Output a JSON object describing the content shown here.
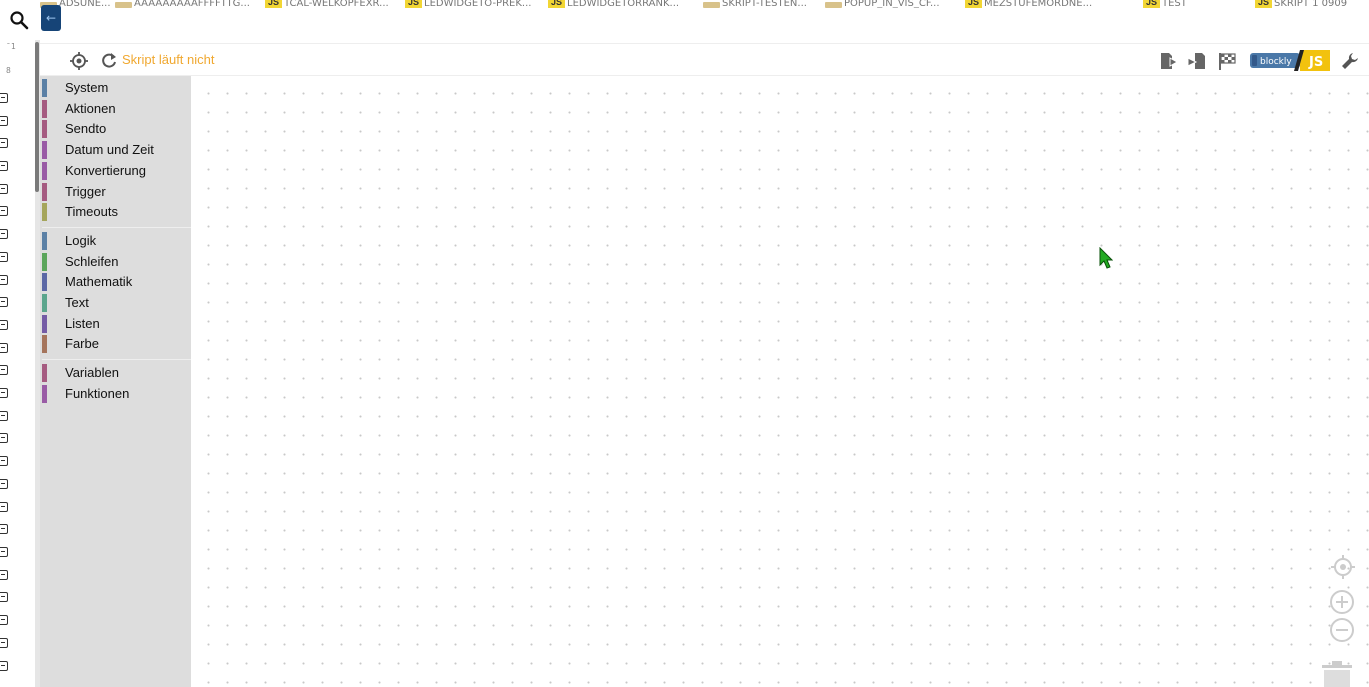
{
  "tabs": [
    {
      "icon": "folder-icon",
      "name": "ADSUNE..."
    },
    {
      "icon": "folder-icon",
      "name": "AAAAAAAAAFFFFTTG..."
    },
    {
      "icon": "js-icon",
      "name": "TCAL-WELKOPFEXR..."
    },
    {
      "icon": "js-icon",
      "name": "LEDWIDGETO-PREK..."
    },
    {
      "icon": "js-icon",
      "name": "LEDWIDGETORRANK..."
    },
    {
      "icon": "folder-icon",
      "name": "SKRIPT-TESTEN..."
    },
    {
      "icon": "folder-icon",
      "name": "POPUP_IN_VIS_CF..."
    },
    {
      "icon": "js-icon",
      "name": "MEZSTUFEMORDNE..."
    },
    {
      "icon": "js-icon",
      "name": "TEST"
    },
    {
      "icon": "js-icon",
      "name": "SKRIPT 1 0909"
    }
  ],
  "tab_js_label": "JS",
  "toolbar": {
    "status": "Skript läuft nicht",
    "blockly_label": "blockly",
    "js_label": "JS"
  },
  "toolbox": {
    "groups": [
      [
        {
          "label": "System",
          "color": "#5b80a5"
        },
        {
          "label": "Aktionen",
          "color": "#a55b80"
        },
        {
          "label": "Sendto",
          "color": "#a55b80"
        },
        {
          "label": "Datum und Zeit",
          "color": "#995ba5"
        },
        {
          "label": "Konvertierung",
          "color": "#995ba5"
        },
        {
          "label": "Trigger",
          "color": "#a55b80"
        },
        {
          "label": "Timeouts",
          "color": "#a5a55b"
        }
      ],
      [
        {
          "label": "Logik",
          "color": "#5b80a5"
        },
        {
          "label": "Schleifen",
          "color": "#5ba55b"
        },
        {
          "label": "Mathematik",
          "color": "#5b67a5"
        },
        {
          "label": "Text",
          "color": "#5ba58c"
        },
        {
          "label": "Listen",
          "color": "#745ba5"
        },
        {
          "label": "Farbe",
          "color": "#a5745b"
        }
      ],
      [
        {
          "label": "Variablen",
          "color": "#a55b80"
        },
        {
          "label": "Funktionen",
          "color": "#995ba5"
        }
      ]
    ]
  },
  "colors": {
    "status": "#f0a830",
    "collapse_button": "#164477",
    "toolbox_bg": "#dddddd",
    "cursor": "#22aa22"
  }
}
